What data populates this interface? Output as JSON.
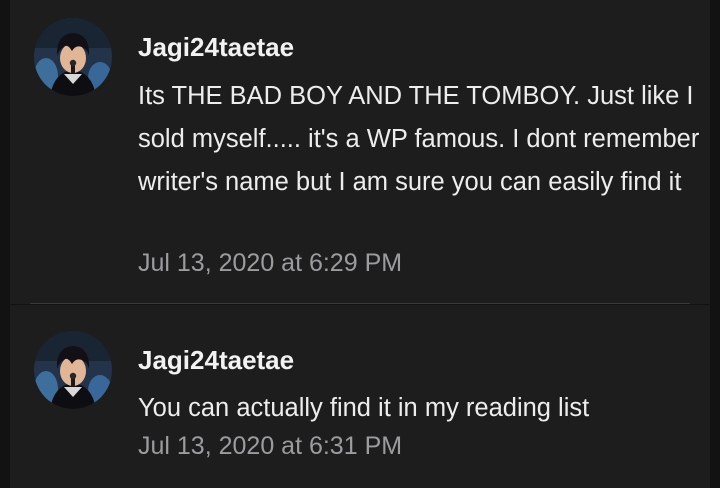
{
  "comments": [
    {
      "author": "Jagi24taetae",
      "avatar_icon": "user-avatar-photo",
      "text": "Its THE BAD BOY AND THE TOMBOY. Just like I sold myself..... it's a WP famous. I dont remember writer's name but I am sure you can easily find it",
      "timestamp": "Jul 13, 2020 at 6:29 PM"
    },
    {
      "author": "Jagi24taetae",
      "avatar_icon": "user-avatar-photo",
      "text": "You can actually find it in my reading list",
      "timestamp": "Jul 13, 2020 at 6:31 PM"
    }
  ],
  "colors": {
    "background": "#121212",
    "card": "#1d1d1e",
    "author_text": "#f2f2f2",
    "body_text": "#ededed",
    "timestamp_text": "#9c9c9f"
  }
}
